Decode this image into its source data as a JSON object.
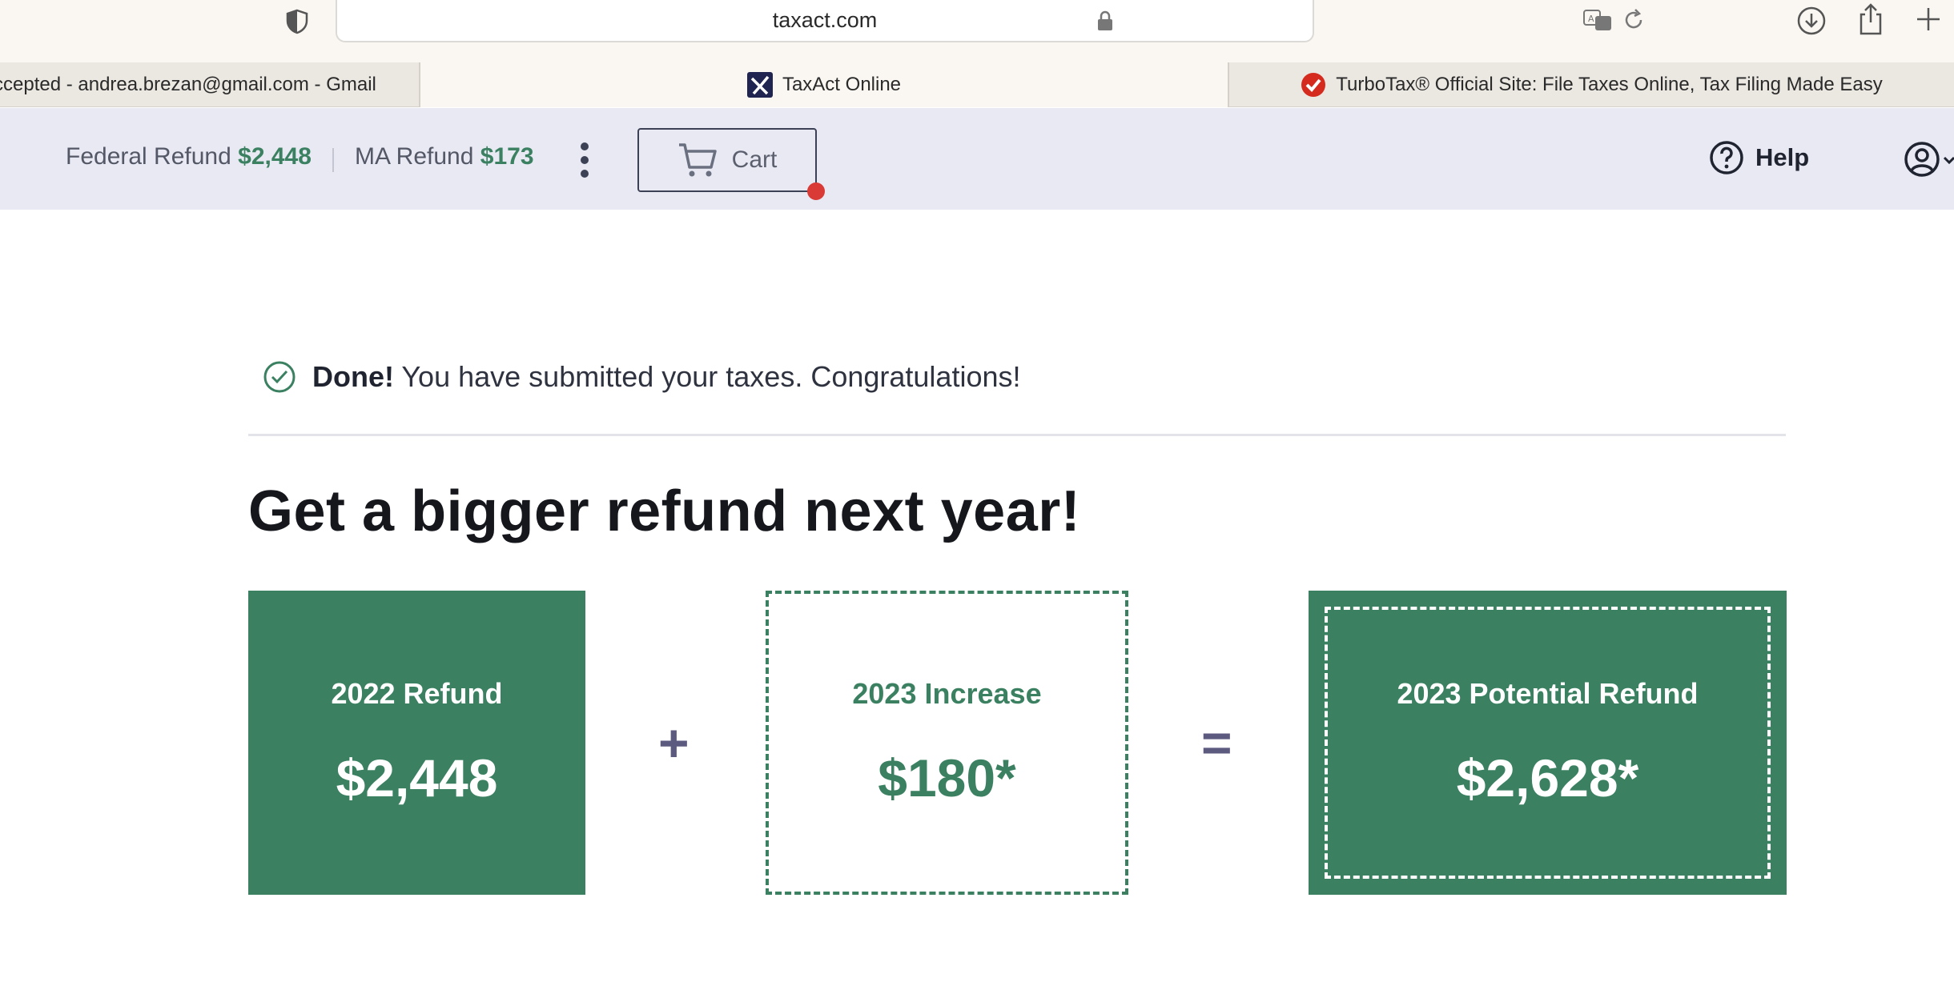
{
  "browser": {
    "url": "taxact.com",
    "tabs": [
      {
        "label": "Accepted - andrea.brezan@gmail.com - Gmail",
        "visible_text": "ccepted - andrea.brezan@gmail.com - Gmail"
      },
      {
        "label": "TaxAct Online",
        "active": true
      },
      {
        "label": "TurboTax® Official Site: File Taxes Online, Tax Filing Made Easy"
      }
    ],
    "icons": [
      "shield-icon",
      "lock-icon",
      "translate-icon",
      "reload-icon",
      "download-icon",
      "share-icon",
      "new-tab-icon"
    ]
  },
  "header": {
    "federal_label": "Federal Refund",
    "federal_amount": "$2,448",
    "state_label": "MA Refund",
    "state_amount": "$173",
    "cart_label": "Cart",
    "help_label": "Help"
  },
  "main": {
    "done_label": "Done!",
    "done_message": " You have submitted your taxes. Congratulations!",
    "headline": "Get a bigger refund next year!",
    "cards": [
      {
        "label": "2022 Refund",
        "value": "$2,448"
      },
      {
        "label": "2023 Increase",
        "value": "$180*"
      },
      {
        "label": "2023 Potential Refund",
        "value": "$2,628*"
      }
    ],
    "operators": {
      "plus": "+",
      "equals": "="
    }
  },
  "colors": {
    "brand_green": "#3a8061",
    "header_bg": "#e8e9f3",
    "operator": "#5c5a7e",
    "notification_dot": "#d93a35"
  }
}
